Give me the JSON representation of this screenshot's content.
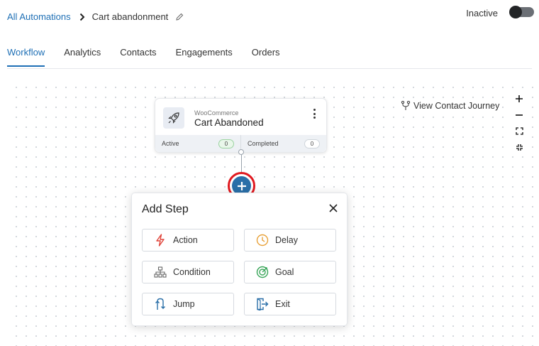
{
  "breadcrumb": {
    "root": "All Automations",
    "current": "Cart abandonment"
  },
  "status": {
    "label": "Inactive",
    "toggle_on": false
  },
  "tabs": [
    {
      "label": "Workflow",
      "active": true
    },
    {
      "label": "Analytics",
      "active": false
    },
    {
      "label": "Contacts",
      "active": false
    },
    {
      "label": "Engagements",
      "active": false
    },
    {
      "label": "Orders",
      "active": false
    }
  ],
  "canvas": {
    "view_journey": "View Contact Journey",
    "zoom_controls": [
      "zoom-in-icon",
      "zoom-out-icon",
      "fit-screen-icon",
      "collapse-icon"
    ]
  },
  "trigger": {
    "source": "WooCommerce",
    "title": "Cart Abandoned",
    "active_label": "Active",
    "active_count": "0",
    "completed_label": "Completed",
    "completed_count": "0"
  },
  "add_step": {
    "title": "Add Step",
    "options": [
      {
        "label": "Action",
        "icon": "lightning-icon",
        "color": "#e0443a"
      },
      {
        "label": "Delay",
        "icon": "clock-icon",
        "color": "#e8a23a"
      },
      {
        "label": "Condition",
        "icon": "hierarchy-icon",
        "color": "#666666"
      },
      {
        "label": "Goal",
        "icon": "target-icon",
        "color": "#3aa65a"
      },
      {
        "label": "Jump",
        "icon": "jump-icon",
        "color": "#2a6fa8"
      },
      {
        "label": "Exit",
        "icon": "exit-icon",
        "color": "#2a6fa8"
      }
    ]
  },
  "colors": {
    "accent": "#1e6fb5",
    "highlight_ring": "#e0191f"
  }
}
